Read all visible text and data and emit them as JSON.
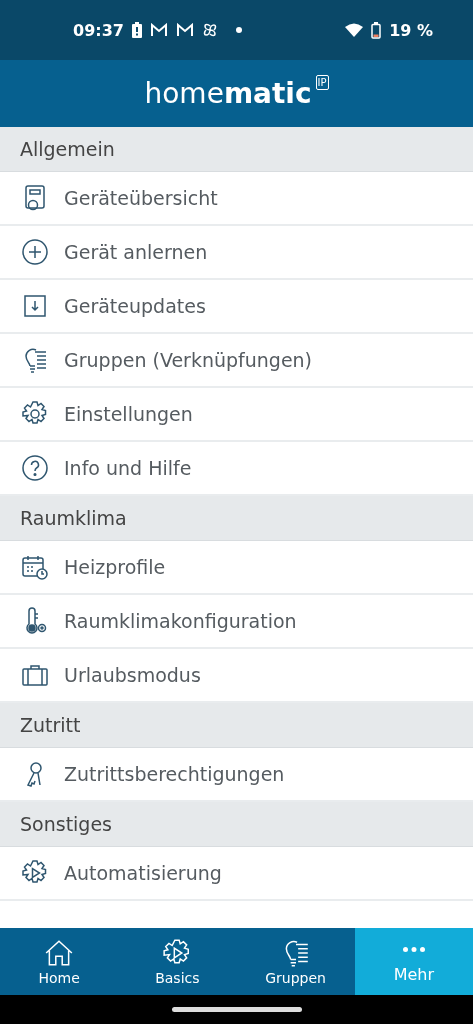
{
  "status_bar": {
    "time": "09:37",
    "battery": "19 %"
  },
  "header": {
    "logo": "home**matic**",
    "badge": "IP"
  },
  "sections": [
    {
      "title": "Allgemein",
      "items": [
        "Geräteübersicht",
        "Gerät anlernen",
        "Geräteupdates",
        "Gruppen (Verknüpfungen)",
        "Einstellungen",
        "Info und Hilfe"
      ]
    },
    {
      "title": "Raumklima",
      "items": [
        "Heizprofile",
        "Raumklimakonfiguration",
        "Urlaubsmodus"
      ]
    },
    {
      "title": "Zutritt",
      "items": [
        "Zutrittsberechtigungen"
      ]
    },
    {
      "title": "Sonstiges",
      "items": [
        "Automatisierung"
      ]
    }
  ],
  "nav": [
    {
      "label": "Home",
      "selected": false
    },
    {
      "label": "Basics",
      "selected": false
    },
    {
      "label": "Gruppen",
      "selected": false
    },
    {
      "label": "Mehr",
      "selected": true
    }
  ]
}
